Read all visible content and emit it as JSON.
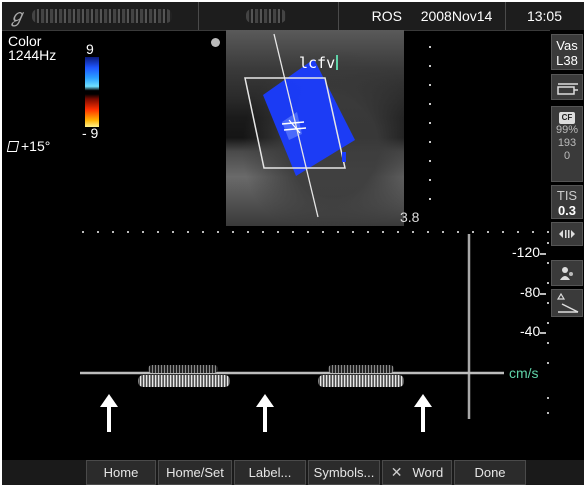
{
  "header": {
    "site": "ROS",
    "date": "2008Nov14",
    "time": "13:05"
  },
  "mode": {
    "name": "Color",
    "prf": "1244Hz",
    "steer": "+15°"
  },
  "color_scale": {
    "top": "9",
    "bottom": "- 9"
  },
  "image": {
    "label": "lcfv",
    "depth": "3.8"
  },
  "spectral_scale": {
    "ticks": [
      "-120",
      "-80",
      "-40"
    ],
    "unit": "cm/s"
  },
  "side_panel": {
    "exam": "Vas",
    "probe": "L38",
    "cf_badge": "CF",
    "cf_gain": "99%",
    "cf_val1": "193",
    "cf_val2": "0",
    "tis_label": "TIS",
    "tis_value": "0.3"
  },
  "softkeys": {
    "home": "Home",
    "home_set": "Home/Set",
    "label": "Label...",
    "symbols": "Symbols...",
    "word": "Word",
    "done": "Done"
  },
  "colors": {
    "background": "#000000",
    "doppler_blue": "#1a3cff",
    "unit_green": "#5fd3a8",
    "button": "#2b2b2b"
  }
}
